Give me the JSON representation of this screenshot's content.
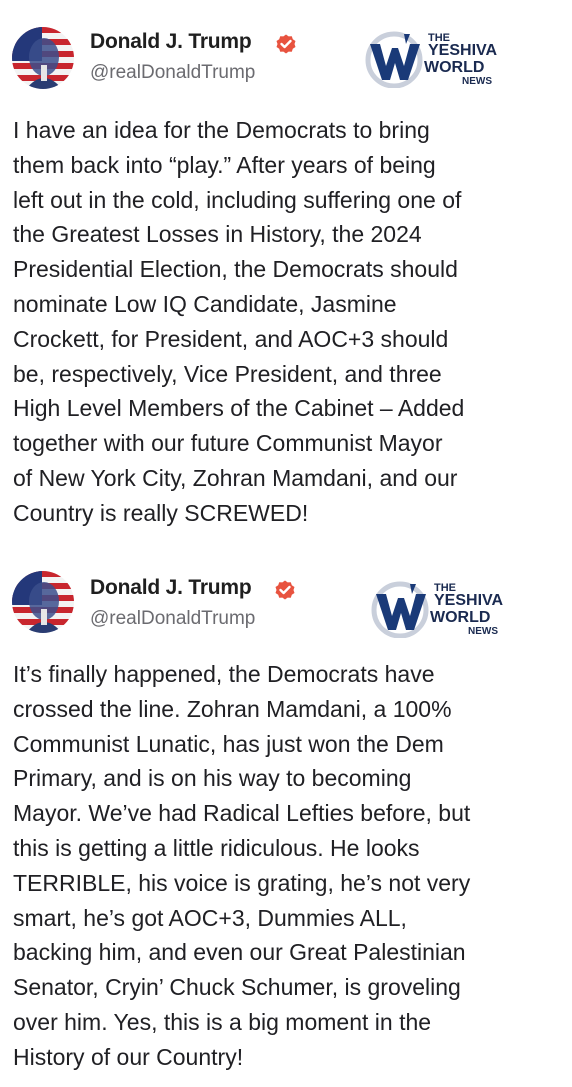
{
  "posts": [
    {
      "author": {
        "name": "Donald J. Trump",
        "handle": "@realDonaldTrump",
        "verified": true
      },
      "watermark": {
        "line1": "THE",
        "line2": "YESHIVA",
        "line3": "WORLD",
        "line4": "NEWS"
      },
      "text": "I have an idea for the Democrats to bring\nthem back into “play.” After years of being\nleft out in the cold, including suffering one of\nthe Greatest Losses in History, the 2024\nPresidential Election, the Democrats should\nnominate Low IQ Candidate, Jasmine\nCrockett, for President, and AOC+3 should\nbe, respectively, Vice President, and three\nHigh Level Members of the Cabinet – Added\ntogether with our future Communist Mayor\nof New York City, Zohran Mamdani, and our\nCountry is really SCREWED!"
    },
    {
      "author": {
        "name": "Donald J. Trump",
        "handle": "@realDonaldTrump",
        "verified": true
      },
      "watermark": {
        "line1": "THE",
        "line2": "YESHIVA",
        "line3": "WORLD",
        "line4": "NEWS"
      },
      "text": "It’s finally happened, the Democrats have\ncrossed the line. Zohran Mamdani, a 100%\nCommunist Lunatic, has just won the Dem\nPrimary, and is on his way to becoming\nMayor. We’ve had Radical Lefties before, but\nthis is getting a little ridiculous. He looks\nTERRIBLE, his voice is grating, he’s not very\nsmart, he’s got AOC+3, Dummies ALL,\nbacking him, and even our Great Palestinian\nSenator, Cryin’ Chuck Schumer, is groveling\nover him. Yes, this is a big moment in the\nHistory of our Country!"
    }
  ],
  "icons": {
    "avatar": "flag-portrait-avatar",
    "verified": "verified-badge-icon",
    "watermark": "yeshiva-world-news-logo"
  },
  "colors": {
    "verified_badge": "#e8533f",
    "name": "#1f1f1f",
    "handle": "#6b6b70",
    "body_text": "#202024",
    "watermark_navy": "#1a2a50"
  }
}
